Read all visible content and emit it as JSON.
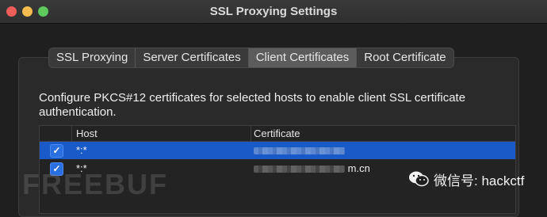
{
  "window": {
    "title": "SSL Proxying Settings"
  },
  "tabs": [
    {
      "label": "SSL Proxying",
      "active": false
    },
    {
      "label": "Server Certificates",
      "active": false
    },
    {
      "label": "Client Certificates",
      "active": true
    },
    {
      "label": "Root Certificate",
      "active": false
    }
  ],
  "description": "Configure PKCS#12 certificates for selected hosts to enable client SSL certificate authentication.",
  "table": {
    "columns": [
      "Host",
      "Certificate"
    ],
    "rows": [
      {
        "checked": true,
        "host": "*:*",
        "certificate": "",
        "selected": true
      },
      {
        "checked": true,
        "host": "*:*",
        "certificate": "m.cn",
        "selected": false
      }
    ]
  },
  "watermarks": {
    "left": "FREEBUF",
    "right": "微信号: hackctf"
  },
  "colors": {
    "selection": "#1a5ac8",
    "checkbox": "#2a6fe0"
  }
}
